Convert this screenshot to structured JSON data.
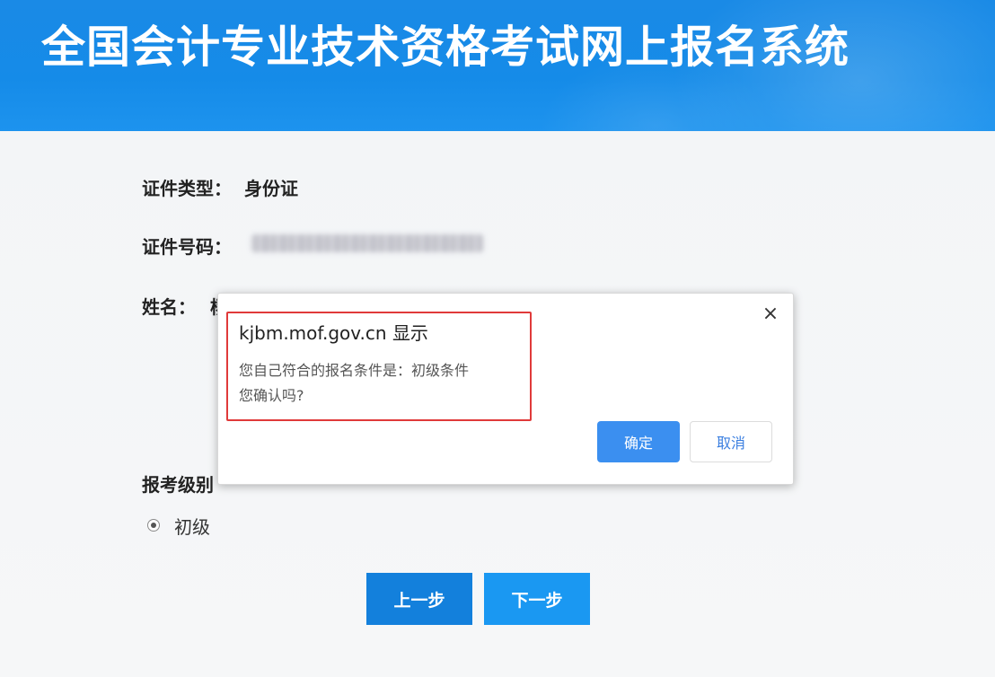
{
  "header": {
    "title": "全国会计专业技术资格考试网上报名系统"
  },
  "form": {
    "id_type_label": "证件类型：",
    "id_type_value": "身份证",
    "id_number_label": "证件号码：",
    "name_label": "姓名：",
    "name_value_partial": "杨",
    "level_label": "报考级别",
    "level_option": "初级"
  },
  "buttons": {
    "prev": "上一步",
    "next": "下一步"
  },
  "dialog": {
    "origin": "kjbm.mof.gov.cn 显示",
    "message_line1": "您自己符合的报名条件是：初级条件",
    "message_line2": "您确认吗?",
    "close_icon": "close-icon",
    "ok_label": "确定",
    "cancel_label": "取消"
  },
  "colors": {
    "header_blue": "#158be8",
    "highlight_red": "#e03a3a",
    "ok_blue": "#3b8ff0"
  }
}
